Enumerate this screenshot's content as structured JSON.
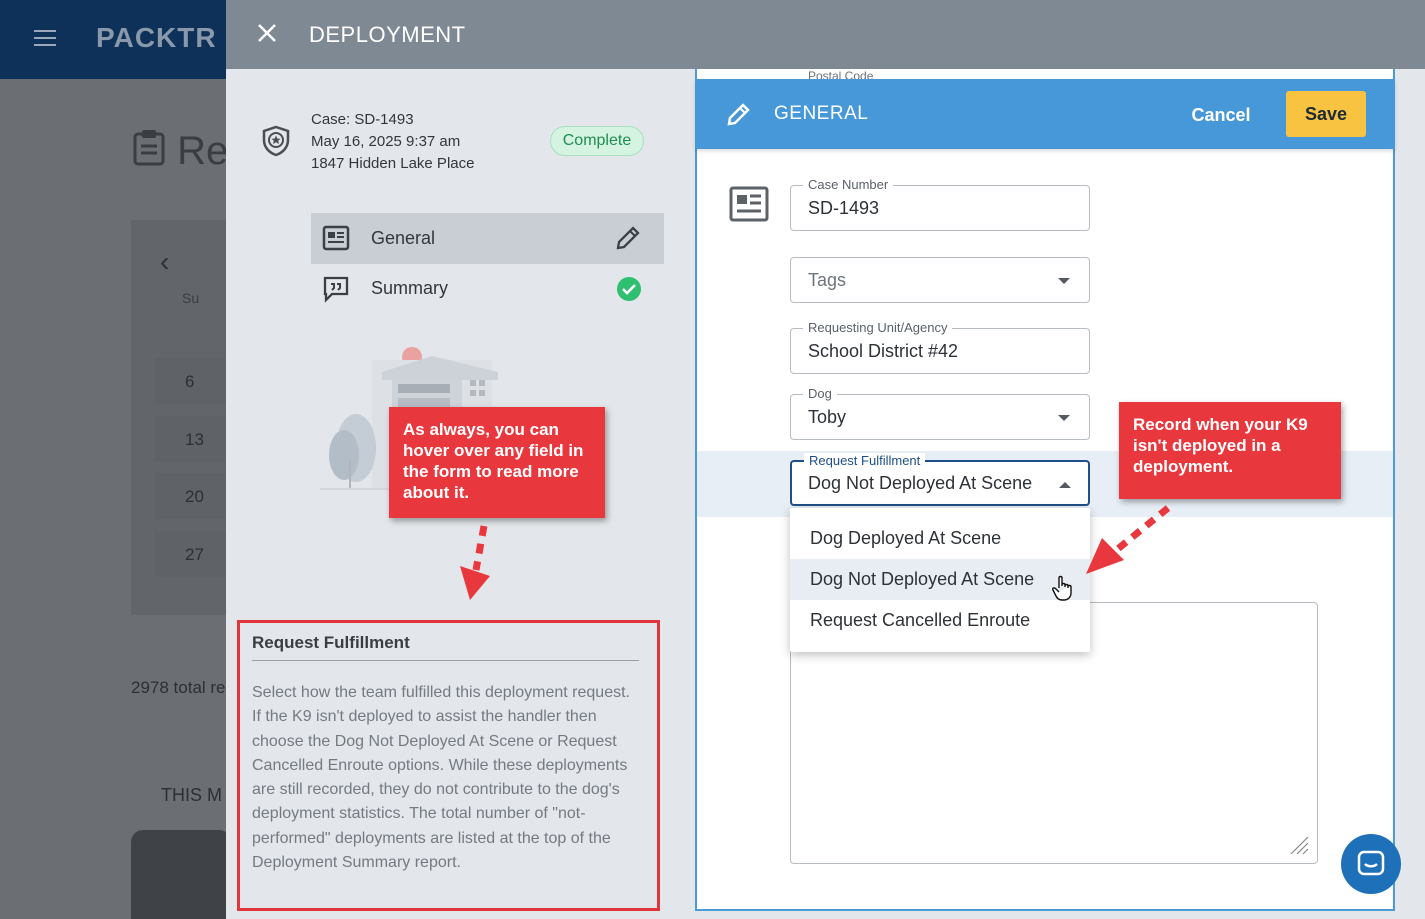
{
  "background": {
    "logo": "PACKTR",
    "title": "Re",
    "weekday": "Su",
    "days": [
      "6",
      "13",
      "20",
      "27"
    ],
    "total_text": "2978 total re",
    "section_text": "THIS M"
  },
  "panel": {
    "title": "DEPLOYMENT",
    "case_number_line": "Case: SD-1493",
    "date_line": "May 16, 2025 9:37 am",
    "address_line": "1847 Hidden Lake Place",
    "status_badge": "Complete",
    "nav": [
      {
        "label": "General",
        "state": "editing"
      },
      {
        "label": "Summary",
        "state": "complete"
      }
    ]
  },
  "callouts": {
    "left": "As always, you can hover over any field in the form to read more about it.",
    "right": "Record when your K9 isn't deployed in a deployment."
  },
  "help": {
    "title": "Request Fulfillment",
    "body": "Select how the team fulfilled this deployment request. If the K9 isn't deployed to assist the handler then choose the Dog Not Deployed At Scene or Request Cancelled Enroute options. While these deployments are still recorded, they do not contribute to the dog's deployment statistics. The total number of \"not-performed\" deployments are listed at the top of the Deployment Summary report."
  },
  "form": {
    "postal_label": "Postal Code",
    "section_title": "GENERAL",
    "cancel_label": "Cancel",
    "save_label": "Save",
    "case_number": {
      "label": "Case Number",
      "value": "SD-1493"
    },
    "tags": {
      "placeholder": "Tags"
    },
    "requesting_unit": {
      "label": "Requesting Unit/Agency",
      "value": "School District #42"
    },
    "dog": {
      "label": "Dog",
      "value": "Toby"
    },
    "request_fulfillment": {
      "label": "Request Fulfillment",
      "value": "Dog Not Deployed At Scene",
      "options": [
        "Dog Deployed At Scene",
        "Dog Not Deployed At Scene",
        "Request Cancelled Enroute"
      ],
      "hovered_index": 1
    }
  },
  "colors": {
    "header_blue": "#4798d9",
    "save_yellow": "#f7c341",
    "callout_red": "#e8383e",
    "complete_green": "#1f8c52"
  }
}
